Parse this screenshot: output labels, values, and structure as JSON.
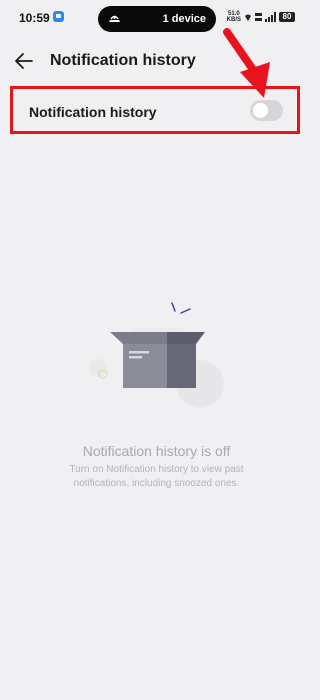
{
  "status_bar": {
    "time": "10:59",
    "island_text": "1 device",
    "net_speed_value": "51.0",
    "net_speed_unit": "KB/S",
    "battery": "80"
  },
  "header": {
    "title": "Notification history"
  },
  "setting": {
    "label": "Notification history",
    "enabled": false
  },
  "empty_state": {
    "title": "Notification history is off",
    "description": "Turn on Notification history to view past notifications, including snoozed ones."
  },
  "colors": {
    "background": "#f0f0f2",
    "highlight_annotation": "#e8131d",
    "toggle_off": "#d6d6d8"
  }
}
